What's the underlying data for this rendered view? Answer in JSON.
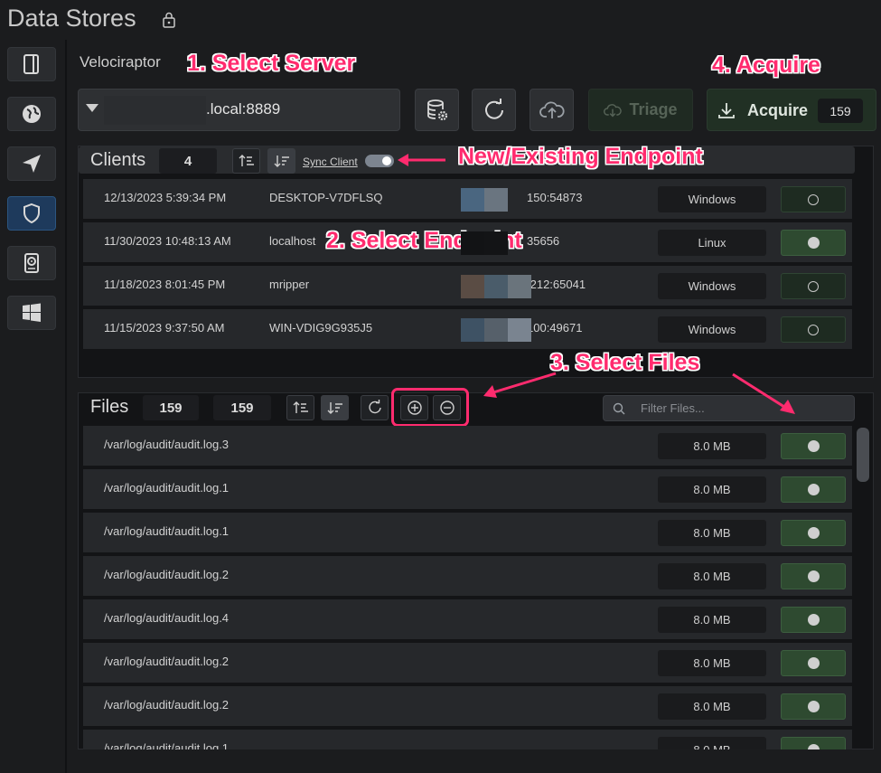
{
  "page": {
    "title": "Data Stores"
  },
  "server": {
    "label": "Velociraptor",
    "value": ".local:8889",
    "triage_label": "Triage",
    "acquire_label": "Acquire",
    "acquire_count": "159"
  },
  "clients": {
    "title": "Clients",
    "count": "4",
    "sync_label": "Sync Client",
    "rows": [
      {
        "date": "12/13/2023 5:39:34 PM",
        "host": "DESKTOP-V7DFLSQ",
        "addr": "150:54873",
        "os": "Windows",
        "selected": false
      },
      {
        "date": "11/30/2023 10:48:13 AM",
        "host": "localhost",
        "addr": "35656",
        "os": "Linux",
        "selected": true
      },
      {
        "date": "11/18/2023 8:01:45 PM",
        "host": "mripper",
        "addr": ".212:65041",
        "os": "Windows",
        "selected": false
      },
      {
        "date": "11/15/2023 9:37:50 AM",
        "host": "WIN-VDIG9G935J5",
        "addr": "100:49671",
        "os": "Windows",
        "selected": false
      }
    ]
  },
  "files": {
    "title": "Files",
    "count_a": "159",
    "count_b": "159",
    "filter_placeholder": "Filter Files...",
    "rows": [
      {
        "path": "/var/log/audit/audit.log.3",
        "size": "8.0 MB"
      },
      {
        "path": "/var/log/audit/audit.log.1",
        "size": "8.0 MB"
      },
      {
        "path": "/var/log/audit/audit.log.1",
        "size": "8.0 MB"
      },
      {
        "path": "/var/log/audit/audit.log.2",
        "size": "8.0 MB"
      },
      {
        "path": "/var/log/audit/audit.log.4",
        "size": "8.0 MB"
      },
      {
        "path": "/var/log/audit/audit.log.2",
        "size": "8.0 MB"
      },
      {
        "path": "/var/log/audit/audit.log.2",
        "size": "8.0 MB"
      },
      {
        "path": "/var/log/audit/audit.log.1",
        "size": "8.0 MB"
      }
    ]
  },
  "annotations": {
    "step1": "1. Select Server",
    "step2": "2. Select Endpoint",
    "step3": "3. Select Files",
    "step4": "4. Acquire",
    "endpoint_note": "New/Existing Endpoint"
  },
  "colors": {
    "annotation": "#ff2b6e",
    "accent_green": "#2e4a30",
    "active_blue": "#1e3a5c"
  },
  "icons": [
    "lock-icon",
    "notebook-icon",
    "globe-icon",
    "send-icon",
    "shield-icon",
    "hard-drive-icon",
    "windows-icon",
    "database-settings-icon",
    "refresh-icon",
    "cloud-upload-icon",
    "cloud-download-icon",
    "download-icon",
    "sort-asc-icon",
    "sort-desc-icon",
    "plus-circle-icon",
    "minus-circle-icon",
    "search-icon"
  ]
}
